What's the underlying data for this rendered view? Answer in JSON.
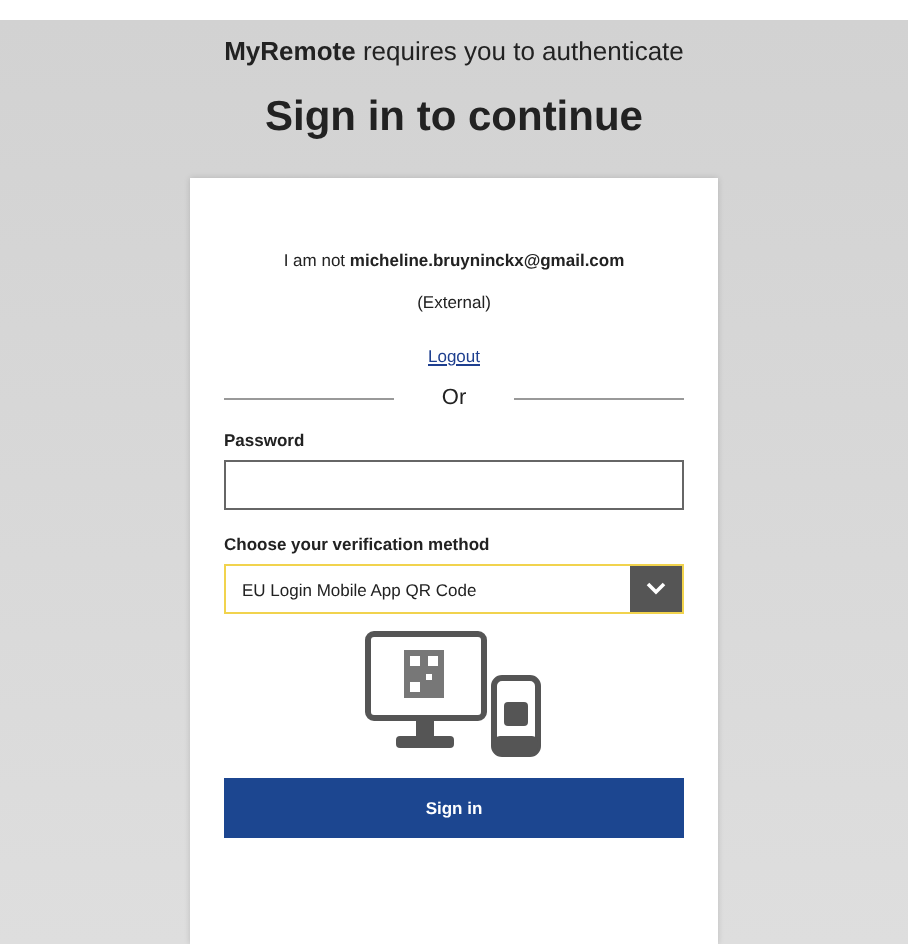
{
  "header": {
    "intro": "**MyRemote** requires you to authenticate",
    "title": "Sign in to continue"
  },
  "card": {
    "identity": "I am not **micheline.bruyninckx@gmail.com**",
    "account_type": "(External)",
    "logout_link": "Logout",
    "divider": "Or",
    "password": {
      "label": "Password"
    },
    "verification": {
      "label": "Choose your verification method",
      "value": "EU Login Mobile App QR Code"
    },
    "submit": "Sign in"
  }
}
